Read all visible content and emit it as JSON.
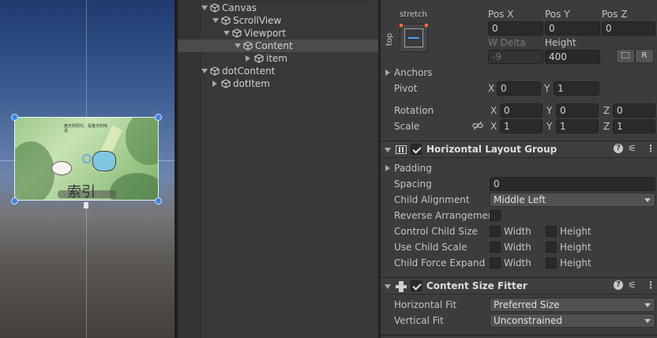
{
  "scene": {
    "card_caption": "索引",
    "card_small_text": "春天的阳光，是春天的味道"
  },
  "hierarchy": {
    "items": [
      {
        "label": "Canvas",
        "indent": 1,
        "expanded": true
      },
      {
        "label": "ScrollView",
        "indent": 2,
        "expanded": true
      },
      {
        "label": "Viewport",
        "indent": 3,
        "expanded": true
      },
      {
        "label": "Content",
        "indent": 4,
        "expanded": true,
        "selected": true
      },
      {
        "label": "item",
        "indent": 5,
        "expanded": false
      },
      {
        "label": "dotContent",
        "indent": 1,
        "expanded": true
      },
      {
        "label": "dotItem",
        "indent": 2,
        "expanded": false
      }
    ]
  },
  "rect_transform": {
    "anchor_preset_h": "stretch",
    "anchor_preset_v": "top",
    "pos_x_label": "Pos X",
    "pos_y_label": "Pos Y",
    "pos_z_label": "Pos Z",
    "pos_x": "0",
    "pos_y": "0",
    "pos_z": "0",
    "w_delta_label": "W Delta",
    "height_label": "Height",
    "w_delta": "-9",
    "height": "400",
    "raw_button": "R",
    "anchors_label": "Anchors",
    "pivot_label": "Pivot",
    "pivot_x": "0",
    "pivot_y": "1",
    "rotation_label": "Rotation",
    "rot_x": "0",
    "rot_y": "0",
    "rot_z": "0",
    "scale_label": "Scale",
    "scale_x": "1",
    "scale_y": "1",
    "scale_z": "1",
    "axis_x": "X",
    "axis_y": "Y",
    "axis_z": "Z"
  },
  "horizontal_layout_group": {
    "title": "Horizontal Layout Group",
    "enabled": true,
    "padding_label": "Padding",
    "spacing_label": "Spacing",
    "spacing": "0",
    "child_alignment_label": "Child Alignment",
    "child_alignment": "Middle Left",
    "reverse_label": "Reverse Arrangement",
    "reverse": false,
    "control_child_size_label": "Control Child Size",
    "use_child_scale_label": "Use Child Scale",
    "child_force_expand_label": "Child Force Expand",
    "width_label": "Width",
    "height_label": "Height",
    "control_child_size": {
      "width": false,
      "height": false
    },
    "use_child_scale": {
      "width": false,
      "height": false
    },
    "child_force_expand": {
      "width": false,
      "height": false
    }
  },
  "content_size_fitter": {
    "title": "Content Size Fitter",
    "enabled": true,
    "horizontal_fit_label": "Horizontal Fit",
    "horizontal_fit": "Preferred Size",
    "vertical_fit_label": "Vertical Fit",
    "vertical_fit": "Unconstrained"
  },
  "colors": {
    "selection_handle": "#3f84e8",
    "panel_bg": "#3c3c3c",
    "field_bg": "#2a2a2a"
  }
}
